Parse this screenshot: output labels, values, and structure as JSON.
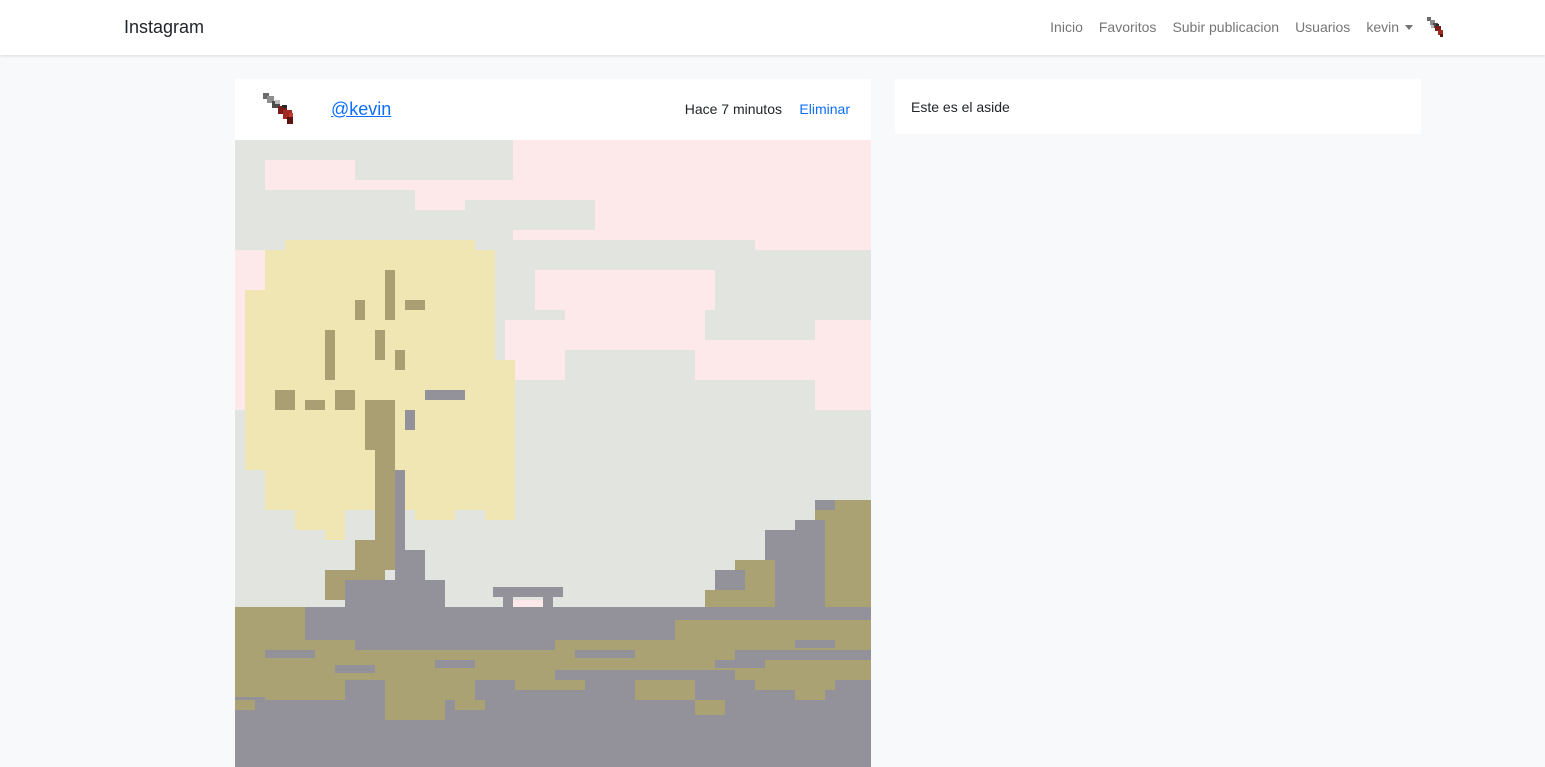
{
  "navbar": {
    "brand": "Instagram",
    "links": [
      "Inicio",
      "Favoritos",
      "Subir publicacion",
      "Usuarios"
    ],
    "user": "kevin",
    "avatar_icon": "user-avatar-icon"
  },
  "post": {
    "username": "@kevin",
    "time": "Hace 7 minutos",
    "delete_label": "Eliminar",
    "avatar_icon": "user-avatar-icon",
    "image": {
      "description_icon": "pixel-art-willow-tree-image",
      "colors": {
        "sky_pink": "#fde9ea",
        "sky_gray": "#e2e4df",
        "foliage": "#efe6b3",
        "foliage_dark": "#a99f72",
        "ground_olive": "#aaa273",
        "ground_gray": "#939199"
      }
    }
  },
  "aside": {
    "text": "Este es el aside"
  }
}
